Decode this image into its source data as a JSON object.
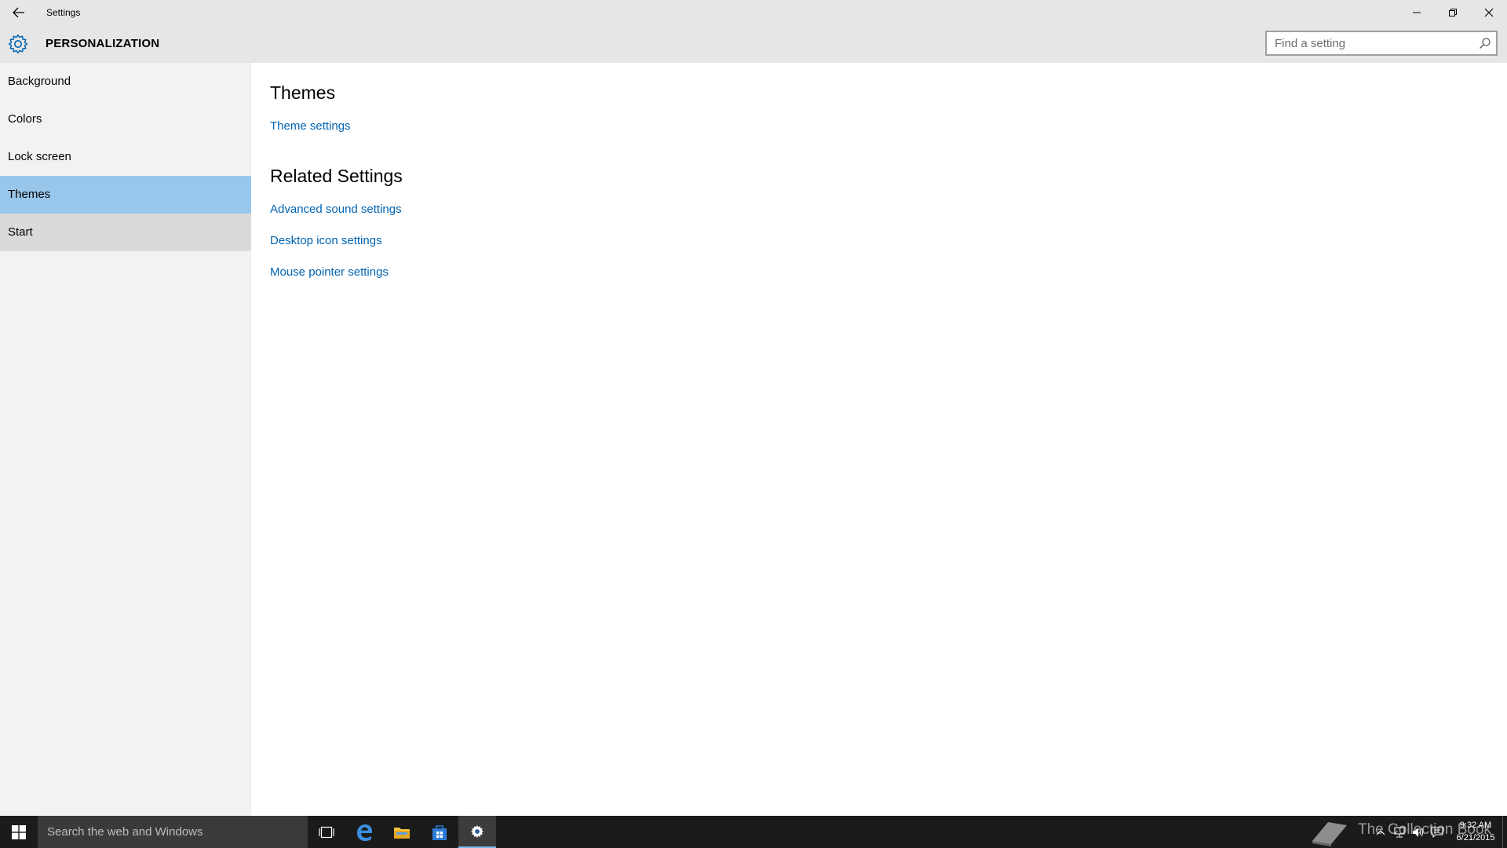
{
  "window": {
    "title": "Settings"
  },
  "header": {
    "title": "PERSONALIZATION",
    "search_placeholder": "Find a setting"
  },
  "sidebar": {
    "items": [
      {
        "label": "Background"
      },
      {
        "label": "Colors"
      },
      {
        "label": "Lock screen"
      },
      {
        "label": "Themes"
      },
      {
        "label": "Start"
      }
    ],
    "selected": "Themes",
    "hovered": "Start"
  },
  "content": {
    "themes_heading": "Themes",
    "theme_settings_link": "Theme settings",
    "related_heading": "Related Settings",
    "related_links": [
      {
        "label": "Advanced sound settings"
      },
      {
        "label": "Desktop icon settings"
      },
      {
        "label": "Mouse pointer settings"
      }
    ]
  },
  "taskbar": {
    "search_text": "Search the web and Windows",
    "pinned": [
      {
        "icon": "task-view-icon"
      },
      {
        "icon": "edge-icon"
      },
      {
        "icon": "file-explorer-icon"
      },
      {
        "icon": "store-icon"
      },
      {
        "icon": "settings-icon"
      }
    ],
    "tray": [
      {
        "icon": "chevron-up-icon"
      },
      {
        "icon": "network-icon"
      },
      {
        "icon": "volume-icon"
      },
      {
        "icon": "action-center-icon"
      }
    ],
    "clock_time": "9:32 AM",
    "clock_date": "6/21/2015",
    "watermark": "The Collection Book"
  },
  "colors": {
    "accent": "#0063b1",
    "selected_nav": "#99c6eb",
    "taskbar": "#1b1b1b"
  }
}
